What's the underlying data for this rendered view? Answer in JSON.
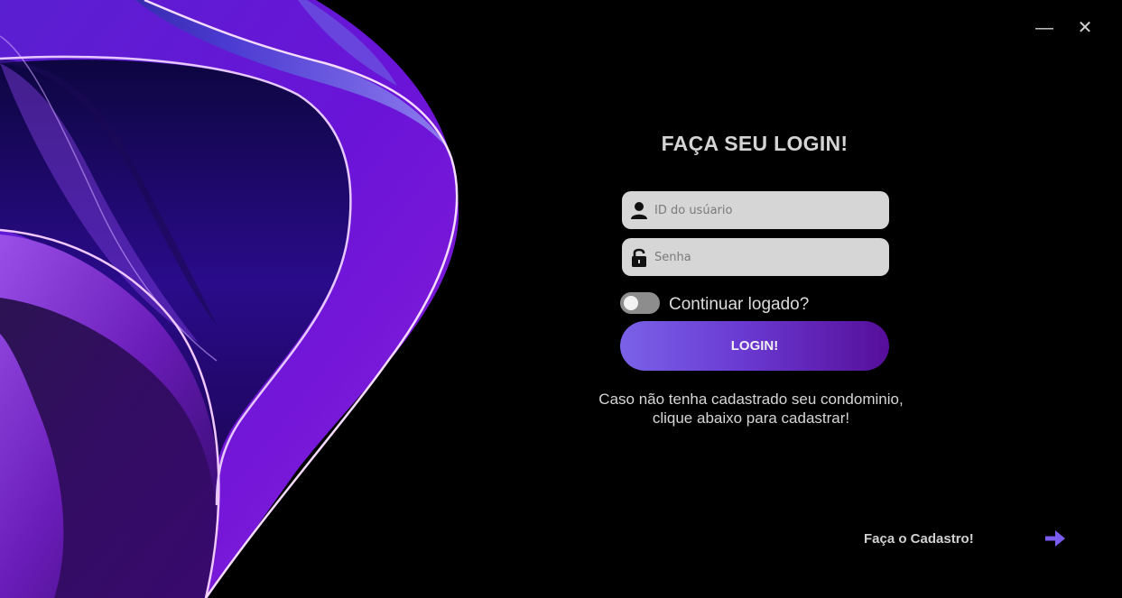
{
  "window": {
    "minimize_glyph": "—",
    "close_glyph": "✕"
  },
  "login": {
    "title": "FAÇA SEU LOGIN!",
    "user_placeholder": "ID do usúario",
    "user_icon": "user-icon",
    "password_placeholder": "Senha",
    "password_icon": "lock-icon",
    "remember_label": "Continuar logado?",
    "remember_on": false,
    "button_label": "LOGIN!"
  },
  "info": {
    "line1": "Caso não tenha cadastrado seu condominio,",
    "line2": "clique abaixo para cadastrar!"
  },
  "signup": {
    "link_label": "Faça o Cadastro!",
    "arrow_icon": "arrow-right-icon"
  },
  "colors": {
    "background": "#000000",
    "accent_start": "#7a62e8",
    "accent_end": "#560e9a",
    "field_bg": "#d6d6d6",
    "arrow": "#7b5cf0"
  }
}
